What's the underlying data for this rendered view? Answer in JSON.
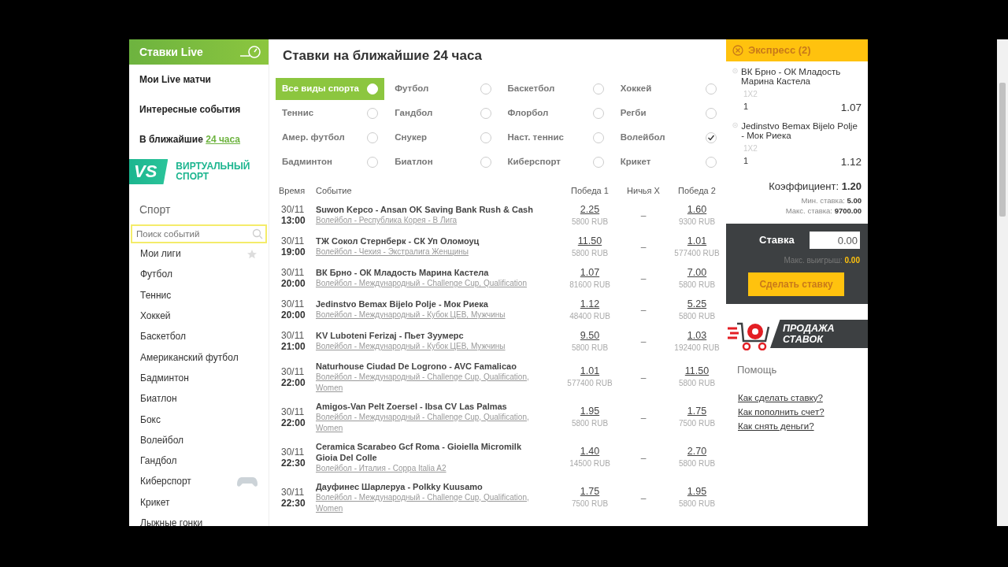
{
  "sidebar": {
    "header": "Ставки Live",
    "links": [
      {
        "text": "Мои Live матчи"
      },
      {
        "text": "Интересные события"
      },
      {
        "text": "В ближайшие",
        "link": "24 часа"
      }
    ],
    "virtual": {
      "badge": "VS",
      "text": "ВИРТУАЛЬНЫЙ СПОРТ"
    },
    "sport_title": "Спорт",
    "search": {
      "placeholder": "Поиск событий"
    },
    "items": [
      {
        "label": "Мои лиги",
        "kind": "favorites"
      },
      {
        "label": "Футбол",
        "kind": "plain"
      },
      {
        "label": "Теннис",
        "kind": "plain"
      },
      {
        "label": "Хоккей",
        "kind": "plain"
      },
      {
        "label": "Баскетбол",
        "kind": "plain"
      },
      {
        "label": "Американский футбол",
        "kind": "plain"
      },
      {
        "label": "Бадминтон",
        "kind": "plain"
      },
      {
        "label": "Биатлон",
        "kind": "plain"
      },
      {
        "label": "Бокс",
        "kind": "plain"
      },
      {
        "label": "Волейбол",
        "kind": "plain"
      },
      {
        "label": "Гандбол",
        "kind": "plain"
      },
      {
        "label": "Киберспорт",
        "kind": "esports"
      },
      {
        "label": "Крикет",
        "kind": "plain"
      },
      {
        "label": "Лыжные гонки",
        "kind": "plain"
      }
    ]
  },
  "main": {
    "title": "Ставки на ближайшие 24 часа",
    "filters": [
      {
        "label": "Все виды спорта",
        "selected": true,
        "checked": false
      },
      {
        "label": "Футбол",
        "selected": false,
        "checked": false
      },
      {
        "label": "Баскетбол",
        "selected": false,
        "checked": false
      },
      {
        "label": "Хоккей",
        "selected": false,
        "checked": false
      },
      {
        "label": "Теннис",
        "selected": false,
        "checked": false
      },
      {
        "label": "Гандбол",
        "selected": false,
        "checked": false
      },
      {
        "label": "Флорбол",
        "selected": false,
        "checked": false
      },
      {
        "label": "Регби",
        "selected": false,
        "checked": false
      },
      {
        "label": "Амер. футбол",
        "selected": false,
        "checked": false
      },
      {
        "label": "Снукер",
        "selected": false,
        "checked": false
      },
      {
        "label": "Наст. теннис",
        "selected": false,
        "checked": false
      },
      {
        "label": "Волейбол",
        "selected": false,
        "checked": true
      },
      {
        "label": "Бадминтон",
        "selected": false,
        "checked": false
      },
      {
        "label": "Биатлон",
        "selected": false,
        "checked": false
      },
      {
        "label": "Киберспорт",
        "selected": false,
        "checked": false
      },
      {
        "label": "Крикет",
        "selected": false,
        "checked": false
      }
    ],
    "columns": [
      "Время",
      "Событие",
      "Победа 1",
      "Ничья X",
      "Победа 2"
    ],
    "rows": [
      {
        "date": "30/11",
        "time": "13:00",
        "event": "Suwon Kepco - Ansan OK Saving Bank Rush & Cash",
        "league": "Волейбол - Республика Корея - В Лига",
        "odd1": "2.25",
        "sum1": "5800 RUB",
        "draw": "–",
        "odd2": "1.60",
        "sum2": "9300 RUB"
      },
      {
        "date": "30/11",
        "time": "19:00",
        "event": "ТЖ Сокол Стернберк - СК Уп Оломоуц",
        "league": "Волейбол - Чехия - Экстралига Женщины",
        "odd1": "11.50",
        "sum1": "5800 RUB",
        "draw": "–",
        "odd2": "1.01",
        "sum2": "577400 RUB"
      },
      {
        "date": "30/11",
        "time": "20:00",
        "event": "ВК Брно - ОК Младость Марина Кастела",
        "league": "Волейбол - Международный - Challenge Cup, Qualification",
        "odd1": "1.07",
        "sum1": "81600 RUB",
        "draw": "–",
        "odd2": "7.00",
        "sum2": "5800 RUB"
      },
      {
        "date": "30/11",
        "time": "20:00",
        "event": "Jedinstvo Bemax Bijelo Polje - Мок Риека",
        "league": "Волейбол - Международный - Кубок ЦЕВ, Мужчины",
        "odd1": "1.12",
        "sum1": "48400 RUB",
        "draw": "–",
        "odd2": "5.25",
        "sum2": "5800 RUB"
      },
      {
        "date": "30/11",
        "time": "21:00",
        "event": "KV Luboteni Ferizaj - Пьет Зуумерс",
        "league": "Волейбол - Международный - Кубок ЦЕВ, Мужчины",
        "odd1": "9.50",
        "sum1": "5800 RUB",
        "draw": "–",
        "odd2": "1.03",
        "sum2": "192400 RUB"
      },
      {
        "date": "30/11",
        "time": "22:00",
        "event": "Naturhouse Ciudad De Logrono - AVC Famalicao",
        "league": "Волейбол - Международный - Challenge Cup, Qualification, Women",
        "odd1": "1.01",
        "sum1": "577400 RUB",
        "draw": "–",
        "odd2": "11.50",
        "sum2": "5800 RUB"
      },
      {
        "date": "30/11",
        "time": "22:00",
        "event": "Amigos-Van Pelt Zoersel - Ibsa CV Las Palmas",
        "league": "Волейбол - Международный - Challenge Cup, Qualification, Women",
        "odd1": "1.95",
        "sum1": "5800 RUB",
        "draw": "–",
        "odd2": "1.75",
        "sum2": "7500 RUB"
      },
      {
        "date": "30/11",
        "time": "22:30",
        "event": "Ceramica Scarabeo Gcf Roma - Gioiella Micromilk Gioia Del Colle",
        "league": "Волейбол - Италия - Coppa Italia A2",
        "odd1": "1.40",
        "sum1": "14500 RUB",
        "draw": "–",
        "odd2": "2.70",
        "sum2": "5800 RUB"
      },
      {
        "date": "30/11",
        "time": "22:30",
        "event": "Дауфинес Шарлеруа - Polkky Kuusamo",
        "league": "Волейбол - Международный - Challenge Cup, Qualification, Women",
        "odd1": "1.75",
        "sum1": "7500 RUB",
        "draw": "–",
        "odd2": "1.95",
        "sum2": "5800 RUB"
      }
    ]
  },
  "betslip": {
    "title": "Экспресс (2)",
    "bets": [
      {
        "event": "ВК Брно - ОК Младость Марина Кастела",
        "market": "1X2",
        "pick": "1",
        "odd": "1.07"
      },
      {
        "event": "Jedinstvo Bemax Bijelo Polje - Мок Риека",
        "market": "1X2",
        "pick": "1",
        "odd": "1.12"
      }
    ],
    "coefficient": "Коэффициент: **1.20**",
    "min_stake": "Мин. ставка: **5.00**",
    "max_stake": "Макс. ставка: **9700.00**",
    "stake_label": "Ставка",
    "stake_value": "0.00",
    "max_win_label": "Макс. выигрыш:",
    "max_win": "0.00",
    "button": "Сделать ставку",
    "banner": "ПРОДАЖА СТАВОК",
    "help_title": "Помощь",
    "help_links": [
      "Как сделать ставку?",
      "Как пополнить счет?",
      "Как снять деньги?"
    ]
  }
}
